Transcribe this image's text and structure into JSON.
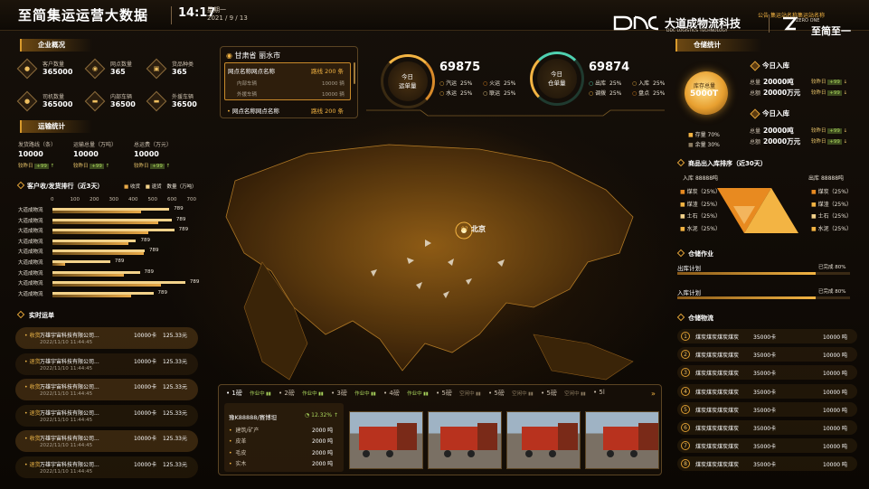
{
  "header": {
    "title": "至简集运运营大数据",
    "time": "14:17",
    "weekday": "星期一",
    "date": "2021 / 9 / 13",
    "notice_label": "公告",
    "notice": "集运站名称集运站名称",
    "brand": "大道成物流科技",
    "brand_sub": "DDC LOGISTICS TECHNOLOGY",
    "brand2": "至简至一",
    "brand2_sub": "ZERO ONE"
  },
  "overview": {
    "title": "企业概况",
    "items": [
      {
        "label": "客户数量",
        "value": "365000",
        "icon": "user-icon",
        "glyph": "●"
      },
      {
        "label": "网点数量",
        "value": "365",
        "icon": "location-pin-icon",
        "glyph": "◉"
      },
      {
        "label": "货品种类",
        "value": "365",
        "icon": "package-icon",
        "glyph": "▣"
      },
      {
        "label": "司机数量",
        "value": "365000",
        "icon": "driver-icon",
        "glyph": "●"
      },
      {
        "label": "内部车辆",
        "value": "36500",
        "icon": "truck-icon",
        "glyph": "▬"
      },
      {
        "label": "外援车辆",
        "value": "36500",
        "icon": "truck-icon",
        "glyph": "▬"
      }
    ]
  },
  "transport": {
    "title": "运输统计",
    "items": [
      {
        "label": "发货路线（条）",
        "value": "10000",
        "cmp": "较昨日",
        "delta": "+99"
      },
      {
        "label": "运输总量（万吨）",
        "value": "10000",
        "cmp": "较昨日",
        "delta": "+99"
      },
      {
        "label": "总运费（万元）",
        "value": "10000",
        "cmp": "较昨日",
        "delta": "+99"
      }
    ]
  },
  "ranking": {
    "title": "客户收/发货排行（近3天）",
    "legend": [
      "收货",
      "退货",
      "数量（万吨）"
    ],
    "ticks": [
      "0",
      "100",
      "200",
      "300",
      "400",
      "500",
      "600",
      "700"
    ],
    "rows": [
      {
        "name": "大道成物流",
        "value": "789",
        "a": 0.72,
        "b": 0.95
      },
      {
        "name": "大道成物流",
        "value": "789",
        "a": 0.86,
        "b": 0.97
      },
      {
        "name": "大道成物流",
        "value": "789",
        "a": 0.78,
        "b": 0.99
      },
      {
        "name": "大道成物流",
        "value": "789",
        "a": 0.62,
        "b": 0.68
      },
      {
        "name": "大道成物流",
        "value": "789",
        "a": 0.74,
        "b": 0.75
      },
      {
        "name": "大道成物流",
        "value": "789",
        "a": 0.1,
        "b": 0.47
      },
      {
        "name": "大道成物流",
        "value": "789",
        "a": 0.58,
        "b": 0.71
      },
      {
        "name": "大道成物流",
        "value": "789",
        "a": 0.88,
        "b": 1.08
      },
      {
        "name": "大道成物流",
        "value": "789",
        "a": 0.64,
        "b": 0.82
      }
    ]
  },
  "realtime": {
    "title": "实时运单",
    "rows": [
      {
        "type": "收货",
        "company": "万雄宇宙科技有限公司...",
        "time": "2022/11/10 11:44:45",
        "qty": "10000卡",
        "amount": "125.33元",
        "hl": true
      },
      {
        "type": "退货",
        "company": "万雄宇宙科技有限公司...",
        "time": "2022/11/10 11:44:45",
        "qty": "10000卡",
        "amount": "125.33元",
        "hl": false
      },
      {
        "type": "收货",
        "company": "万雄宇宙科技有限公司...",
        "time": "2022/11/10 11:44:45",
        "qty": "10000卡",
        "amount": "125.33元",
        "hl": true
      },
      {
        "type": "退货",
        "company": "万雄宇宙科技有限公司...",
        "time": "2022/11/10 11:44:45",
        "qty": "10000卡",
        "amount": "125.33元",
        "hl": false
      },
      {
        "type": "收货",
        "company": "万雄宇宙科技有限公司...",
        "time": "2022/11/10 11:44:45",
        "qty": "10000卡",
        "amount": "125.33元",
        "hl": true
      },
      {
        "type": "退货",
        "company": "万雄宇宙科技有限公司...",
        "time": "2022/11/10 11:44:45",
        "qty": "10000卡",
        "amount": "125.33元",
        "hl": false
      }
    ]
  },
  "network": {
    "region": "甘肃省 丽水市",
    "header_name": "网点名称网点名称",
    "header_route": "路线 200 条",
    "subs": [
      {
        "name": "内部车辆",
        "value": "10000 辆"
      },
      {
        "name": "外援车辆",
        "value": "10000 辆"
      }
    ],
    "footer_name": "网点名称网点名称",
    "footer_route": "路线 200 条"
  },
  "today_transport": {
    "label1": "今日",
    "label2": "运单量",
    "total": "69875",
    "items": [
      {
        "name": "汽运",
        "pct": "25%"
      },
      {
        "name": "火运",
        "pct": "25%"
      },
      {
        "name": "水运",
        "pct": "25%"
      },
      {
        "name": "联运",
        "pct": "25%"
      }
    ]
  },
  "today_warehouse": {
    "label1": "今日",
    "label2": "仓单量",
    "total": "69874",
    "items": [
      {
        "name": "出库",
        "pct": "25%"
      },
      {
        "name": "入库",
        "pct": "25%"
      },
      {
        "name": "调拨",
        "pct": "25%"
      },
      {
        "name": "盘点",
        "pct": "25%"
      }
    ]
  },
  "map": {
    "city": "北京",
    "city_code": "02"
  },
  "warehouse": {
    "title": "仓储统计",
    "stock_label": "库存总量",
    "stock_value": "5000T",
    "stock_items": [
      {
        "name": "存量",
        "pct": "70%"
      },
      {
        "name": "余量",
        "pct": "30%"
      }
    ],
    "in_title": "今日入库",
    "in_rows": [
      {
        "label": "总量",
        "value": "20000吨",
        "cmp": "较昨日",
        "delta": "+99"
      },
      {
        "label": "总额",
        "value": "20000万元",
        "cmp": "较昨日",
        "delta": "+99"
      }
    ],
    "out_title": "今日入库",
    "out_rows": [
      {
        "label": "总量",
        "value": "20000吨",
        "cmp": "较昨日",
        "delta": "+99"
      },
      {
        "label": "总额",
        "value": "20000万元",
        "cmp": "较昨日",
        "delta": "+99"
      }
    ]
  },
  "goods": {
    "title": "商品出入库排序（近30天）",
    "in_label": "入库",
    "in_value": "88888吨",
    "out_label": "出库",
    "out_value": "88888吨",
    "left": [
      {
        "name": "煤炭",
        "pct": "（25%）"
      },
      {
        "name": "煤渣",
        "pct": "（25%）"
      },
      {
        "name": "土石",
        "pct": "（25%）"
      },
      {
        "name": "水泥",
        "pct": "（25%）"
      }
    ],
    "right": [
      {
        "name": "煤炭",
        "pct": "（25%）"
      },
      {
        "name": "煤渣",
        "pct": "（25%）"
      },
      {
        "name": "土石",
        "pct": "（25%）"
      },
      {
        "name": "水泥",
        "pct": "（25%）"
      }
    ]
  },
  "ops": {
    "title": "仓储作业",
    "out_plan": "出库计划",
    "out_done": "已完成 80%",
    "in_plan": "入库计划",
    "in_done": "已完成 80%",
    "out_pct": 0.8,
    "in_pct": 0.8
  },
  "logistics": {
    "title": "仓储物流",
    "rows": [
      {
        "n": "1",
        "name": "煤炭煤炭煤炭煤炭",
        "qty": "35000卡",
        "weight": "10000 吨"
      },
      {
        "n": "2",
        "name": "煤炭煤炭煤炭煤炭",
        "qty": "35000卡",
        "weight": "10000 吨"
      },
      {
        "n": "3",
        "name": "煤炭煤炭煤炭煤炭",
        "qty": "35000卡",
        "weight": "10000 吨"
      },
      {
        "n": "4",
        "name": "煤炭煤炭煤炭煤炭",
        "qty": "35000卡",
        "weight": "10000 吨"
      },
      {
        "n": "5",
        "name": "煤炭煤炭煤炭煤炭",
        "qty": "35000卡",
        "weight": "10000 吨"
      },
      {
        "n": "6",
        "name": "煤炭煤炭煤炭煤炭",
        "qty": "35000卡",
        "weight": "10000 吨"
      },
      {
        "n": "7",
        "name": "煤炭煤炭煤炭煤炭",
        "qty": "35000卡",
        "weight": "10000 吨"
      },
      {
        "n": "8",
        "name": "煤炭煤炭煤炭煤炭",
        "qty": "35000卡",
        "weight": "10000 吨"
      }
    ]
  },
  "scales": {
    "tabs": [
      {
        "label": "1磅",
        "status": "作业中"
      },
      {
        "label": "2磅",
        "status": "作业中"
      },
      {
        "label": "3磅",
        "status": "作业中"
      },
      {
        "label": "4磅",
        "status": "作业中"
      },
      {
        "label": "5磅",
        "status": "空闲中"
      },
      {
        "label": "5磅",
        "status": "空闲中"
      },
      {
        "label": "5磅",
        "status": "空闲中"
      },
      {
        "label": "5l",
        "status": ""
      }
    ],
    "more": "»",
    "plate": "豫K88888/赛博坦",
    "pct": "12.32%",
    "items": [
      {
        "name": "建筑/矿产",
        "value": "2000 吨"
      },
      {
        "name": "皮革",
        "value": "2000 吨"
      },
      {
        "name": "毛皮",
        "value": "2000 吨"
      },
      {
        "name": "实木",
        "value": "2000 吨"
      }
    ]
  },
  "colors": {
    "accent": "#f3b443",
    "green": "#a9d45c",
    "bg": "#0c0803"
  }
}
